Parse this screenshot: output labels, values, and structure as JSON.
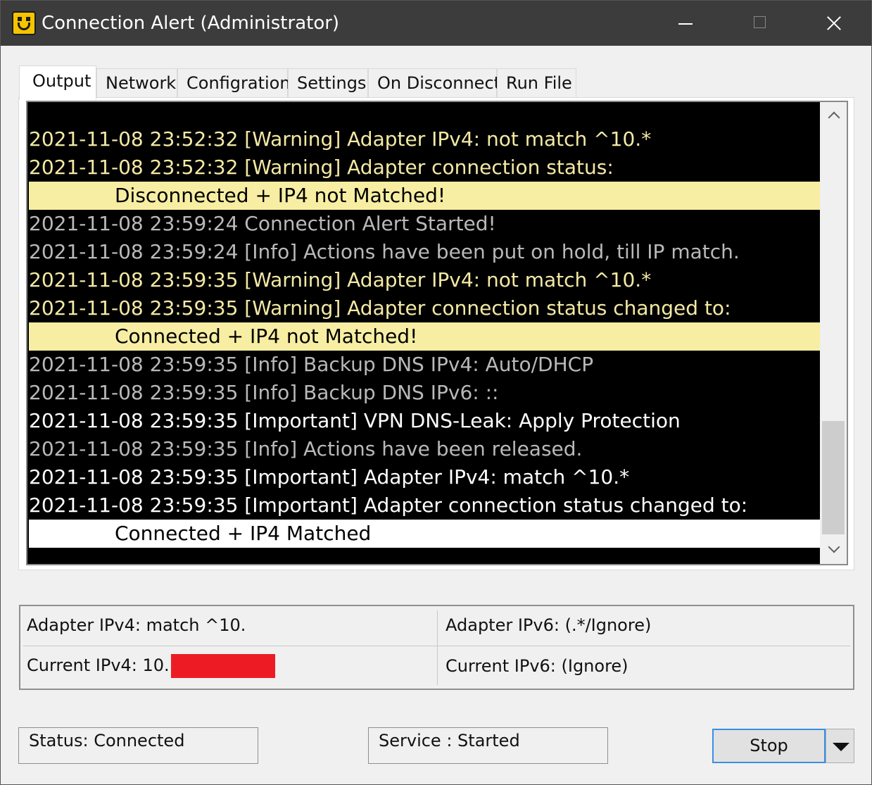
{
  "window": {
    "title": "Connection Alert (Administrator)",
    "icon": "smiley-app-icon",
    "controls": [
      "minimize-icon",
      "maximize-icon",
      "close-icon"
    ]
  },
  "tabs": [
    {
      "label": "Output",
      "active": true
    },
    {
      "label": "Network",
      "active": false
    },
    {
      "label": "Configration",
      "active": false
    },
    {
      "label": "Settings",
      "active": false
    },
    {
      "label": "On Disconnect",
      "active": false
    },
    {
      "label": "Run File",
      "active": false
    }
  ],
  "log": [
    {
      "text": "2021-11-08 23:52:32 [Warning] Adapter IPv4: not match ^10.*",
      "level": "warning"
    },
    {
      "text": "2021-11-08 23:52:32 [Warning] Adapter connection status:",
      "level": "warning"
    },
    {
      "text": "Disconnected  + IP4 not Matched!",
      "level": "hl-yellow"
    },
    {
      "text": "2021-11-08 23:59:24 Connection Alert Started!",
      "level": "info"
    },
    {
      "text": "2021-11-08 23:59:24 [Info] Actions have been put on hold, till IP match.",
      "level": "info"
    },
    {
      "text": "2021-11-08 23:59:35 [Warning] Adapter IPv4: not match ^10.*",
      "level": "warning"
    },
    {
      "text": "2021-11-08 23:59:35 [Warning] Adapter connection status changed to:",
      "level": "warning"
    },
    {
      "text": "Connected  + IP4 not Matched!",
      "level": "hl-yellow"
    },
    {
      "text": "2021-11-08 23:59:35 [Info] Backup DNS IPv4: Auto/DHCP",
      "level": "info"
    },
    {
      "text": "2021-11-08 23:59:35 [Info] Backup DNS IPv6: ::",
      "level": "info"
    },
    {
      "text": "2021-11-08 23:59:35 [Important] VPN DNS-Leak: Apply Protection",
      "level": "important"
    },
    {
      "text": "2021-11-08 23:59:35 [Info] Actions have been released.",
      "level": "info"
    },
    {
      "text": "2021-11-08 23:59:35 [Important] Adapter IPv4: match ^10.*",
      "level": "important"
    },
    {
      "text": "2021-11-08 23:59:35 [Important] Adapter connection status changed to:",
      "level": "important"
    },
    {
      "text": "Connected  + IP4 Matched",
      "level": "hl-white"
    }
  ],
  "ip_info": {
    "adapter_ipv4": "Adapter IPv4: match ^10.",
    "adapter_ipv6": "Adapter IPv6: (.*/Ignore)",
    "current_ipv4": "Current IPv4: 10.",
    "current_ipv6": "Current IPv6: (Ignore)",
    "redaction_color": "#ed1c24"
  },
  "status": {
    "connection": "Status: Connected",
    "service": "Service : Started"
  },
  "actions": {
    "stop_label": "Stop",
    "dropdown_icon": "triangle-down-icon"
  }
}
